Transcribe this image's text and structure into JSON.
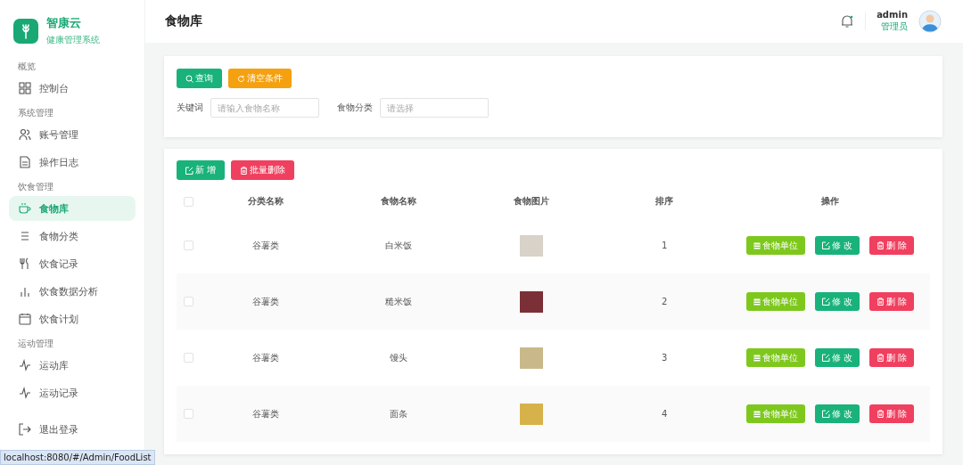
{
  "brand": {
    "name": "智康云",
    "subtitle": "健康管理系统"
  },
  "sidebar": {
    "groups": [
      {
        "title": "概览",
        "items": [
          {
            "label": "控制台",
            "selected": false
          }
        ]
      },
      {
        "title": "系统管理",
        "items": [
          {
            "label": "账号管理",
            "selected": false
          },
          {
            "label": "操作日志",
            "selected": false
          }
        ]
      },
      {
        "title": "饮食管理",
        "items": [
          {
            "label": "食物库",
            "selected": true
          },
          {
            "label": "食物分类",
            "selected": false
          },
          {
            "label": "饮食记录",
            "selected": false
          },
          {
            "label": "饮食数据分析",
            "selected": false
          },
          {
            "label": "饮食计划",
            "selected": false
          }
        ]
      },
      {
        "title": "运动管理",
        "items": [
          {
            "label": "运动库",
            "selected": false
          },
          {
            "label": "运动记录",
            "selected": false
          }
        ]
      }
    ],
    "logout": "退出登录"
  },
  "header": {
    "title": "食物库",
    "user": {
      "name": "admin",
      "role": "管理员"
    }
  },
  "filter": {
    "buttons": [
      {
        "label": "查询",
        "kind": "search"
      },
      {
        "label": "清空条件",
        "kind": "reset"
      }
    ],
    "fields": [
      {
        "label": "关键词",
        "placeholder": "请输入食物名称"
      },
      {
        "label": "食物分类",
        "placeholder": "请选择"
      }
    ]
  },
  "toolbar": [
    {
      "label": "新 增",
      "kind": "add"
    },
    {
      "label": "批量删除",
      "kind": "delete"
    }
  ],
  "table": {
    "columns": [
      "分类名称",
      "食物名称",
      "食物图片",
      "排序",
      "操作"
    ],
    "header_checked": false,
    "rows": [
      {
        "checked": false,
        "category": "谷薯类",
        "name": "白米饭",
        "sort": "1",
        "actions": [
          {
            "label": "食物单位",
            "kind": "unit"
          },
          {
            "label": "修 改",
            "kind": "edit"
          },
          {
            "label": "删 除",
            "kind": "delete"
          }
        ]
      },
      {
        "checked": false,
        "category": "谷薯类",
        "name": "糙米饭",
        "sort": "2",
        "actions": [
          {
            "label": "食物单位",
            "kind": "unit"
          },
          {
            "label": "修 改",
            "kind": "edit"
          },
          {
            "label": "删 除",
            "kind": "delete"
          }
        ]
      },
      {
        "checked": false,
        "category": "谷薯类",
        "name": "馒头",
        "sort": "3",
        "actions": [
          {
            "label": "食物单位",
            "kind": "unit"
          },
          {
            "label": "修 改",
            "kind": "edit"
          },
          {
            "label": "删 除",
            "kind": "delete"
          }
        ]
      },
      {
        "checked": false,
        "category": "谷薯类",
        "name": "面条",
        "sort": "4",
        "actions": [
          {
            "label": "食物单位",
            "kind": "unit"
          },
          {
            "label": "修 改",
            "kind": "edit"
          },
          {
            "label": "删 除",
            "kind": "delete"
          }
        ]
      }
    ]
  },
  "status_url": "localhost:8080/#/Admin/FoodList"
}
